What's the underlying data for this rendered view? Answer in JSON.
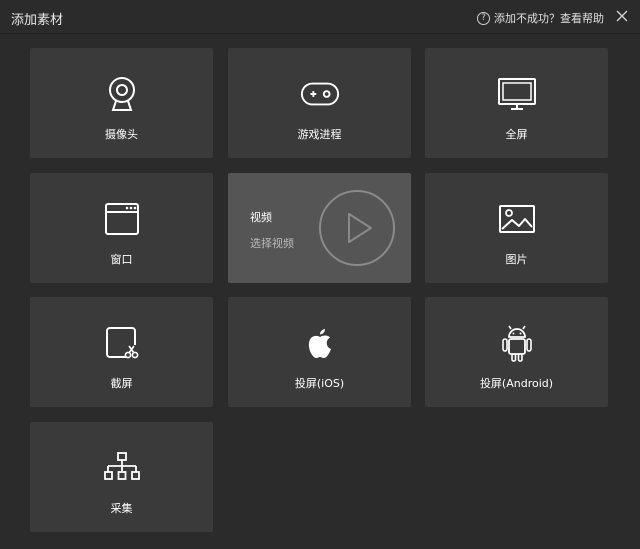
{
  "window": {
    "title": "添加素材",
    "help_text": "添加不成功？查看帮助"
  },
  "tiles": [
    {
      "label": "摄像头"
    },
    {
      "label": "游戏进程"
    },
    {
      "label": "全屏"
    },
    {
      "label": "窗口"
    },
    {
      "title": "视频",
      "subtitle": "选择视频"
    },
    {
      "label": "图片"
    },
    {
      "label": "截屏"
    },
    {
      "label": "投屏(iOS)"
    },
    {
      "label": "投屏(Android)"
    },
    {
      "label": "采集"
    }
  ],
  "icons": [
    "camera-icon",
    "gamepad-icon",
    "monitor-icon",
    "window-icon",
    "play-icon",
    "image-icon",
    "screenshot-icon",
    "apple-icon",
    "android-icon",
    "capture-icon"
  ],
  "colors": {
    "background": "#2b2b2b",
    "tile": "#3a3a3a",
    "tile_active": "#555555"
  }
}
